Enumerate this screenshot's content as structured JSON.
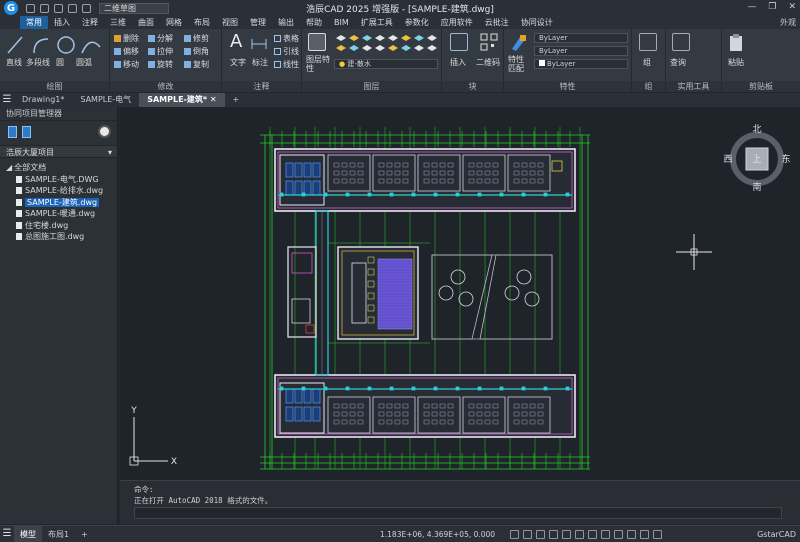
{
  "title": {
    "app_title": "浩辰CAD 2025 增强版 - [SAMPLE-建筑.dwg]",
    "workspace": "二维草图",
    "window_buttons": [
      "—",
      "❐",
      "✕"
    ]
  },
  "menu": {
    "items": [
      "常用",
      "插入",
      "注释",
      "三维",
      "曲面",
      "网格",
      "布局",
      "视图",
      "管理",
      "输出",
      "帮助",
      "BIM",
      "扩展工具",
      "参数化",
      "应用软件",
      "云批注",
      "协同设计"
    ],
    "active_index": 0,
    "right_label": "外观"
  },
  "ribbon": {
    "draw": {
      "title": "绘图",
      "tools": [
        "直线",
        "多段线",
        "圆",
        "圆弧"
      ]
    },
    "modify": {
      "title": "修改",
      "tools": [
        "删除",
        "分解",
        "修剪",
        "偏移",
        "拉伸",
        "倒角",
        "移动",
        "旋转",
        "复制"
      ]
    },
    "annotation": {
      "title": "注释",
      "tools": [
        "文字",
        "标注",
        "表格",
        "引线",
        "线性"
      ]
    },
    "layer": {
      "title": "图层",
      "tools": [
        "图层特性"
      ],
      "current_layer": "建-散水"
    },
    "block": {
      "title": "块",
      "tools": [
        "插入",
        "二维码"
      ]
    },
    "properties": {
      "title": "特性",
      "tools": [
        "特性匹配"
      ],
      "color": "ByLayer",
      "linetype": "ByLayer",
      "lineweight": "ByLayer"
    },
    "group": {
      "title": "组",
      "tools": [
        "组"
      ]
    },
    "utilities": {
      "title": "实用工具",
      "tools": [
        "查询"
      ]
    },
    "clipboard": {
      "title": "剪贴板",
      "tools": [
        "粘贴"
      ]
    }
  },
  "doc_tabs": {
    "tabs": [
      "Drawing1*",
      "SAMPLE-电气",
      "SAMPLE-建筑*"
    ],
    "active_index": 2,
    "add_label": "+"
  },
  "left_panel": {
    "title": "协同项目管理器",
    "project": "浩辰大厦项目",
    "root": "全部文档",
    "files": [
      "SAMPLE-电气.DWG",
      "SAMPLE-给排水.dwg",
      "SAMPLE-建筑.dwg",
      "SAMPLE-暖通.dwg",
      "住宅楼.dwg",
      "总图施工图.dwg"
    ],
    "selected_index": 2
  },
  "viewcube": {
    "north": "北",
    "south": "南",
    "east": "东",
    "west": "西",
    "face": "上"
  },
  "ucs": {
    "x": "X",
    "y": "Y"
  },
  "command": {
    "lines": [
      "命令:",
      "正在打开 AutoCAD 2018 格式的文件。"
    ]
  },
  "status": {
    "tabs": [
      "模型",
      "布局1"
    ],
    "active_index": 0,
    "add_label": "+",
    "coordinates": "1.183E+06, 4.369E+05, 0.000",
    "brand": "GstarCAD"
  },
  "colors": {
    "accent": "#1f5f9a",
    "canvas_bg": "#1f232a",
    "wall": "#e8e8f0",
    "dimension": "#26d026",
    "column": "#2fd0d8",
    "seating": "#6b57d6",
    "selected_file": "#1d63b5"
  }
}
